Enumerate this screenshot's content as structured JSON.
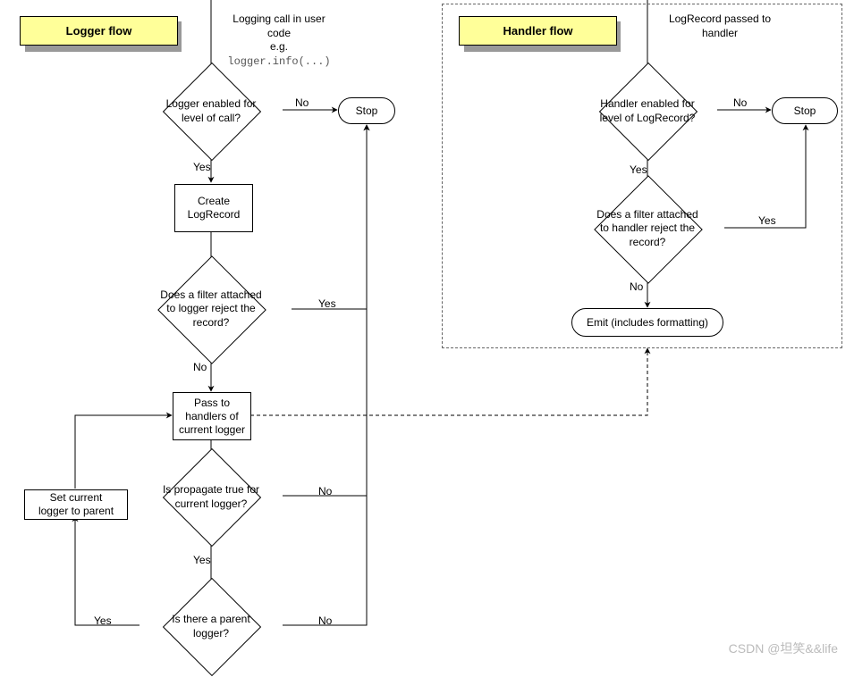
{
  "titles": {
    "logger": "Logger flow",
    "handler": "Handler flow"
  },
  "notes": {
    "start_l1": "Logging call in user code",
    "start_l2": "e.g.",
    "start_l3": "logger.info(...)",
    "handler_start_l1": "LogRecord passed to",
    "handler_start_l2": "handler"
  },
  "diamonds": {
    "d1_l1": "Logger enabled for",
    "d1_l2": "level of call?",
    "d2_l1": "Does a filter attached",
    "d2_l2": "to logger reject the",
    "d2_l3": "record?",
    "d3_l1": "Is propagate true for",
    "d3_l2": "current logger?",
    "d4_l1": "Is there a parent",
    "d4_l2": "logger?",
    "h1_l1": "Handler enabled for",
    "h1_l2": "level of LogRecord?",
    "h2_l1": "Does a filter attached",
    "h2_l2": "to handler reject the",
    "h2_l3": "record?"
  },
  "rects": {
    "create_l1": "Create",
    "create_l2": "LogRecord",
    "pass_l1": "Pass to",
    "pass_l2": "handlers of",
    "pass_l3": "current logger",
    "setparent_l1": "Set current",
    "setparent_l2": "logger to parent"
  },
  "terms": {
    "stop_logger": "Stop",
    "stop_handler": "Stop",
    "emit": "Emit (includes formatting)"
  },
  "labels": {
    "yes": "Yes",
    "no": "No"
  },
  "watermark": "CSDN @坦笑&&life"
}
